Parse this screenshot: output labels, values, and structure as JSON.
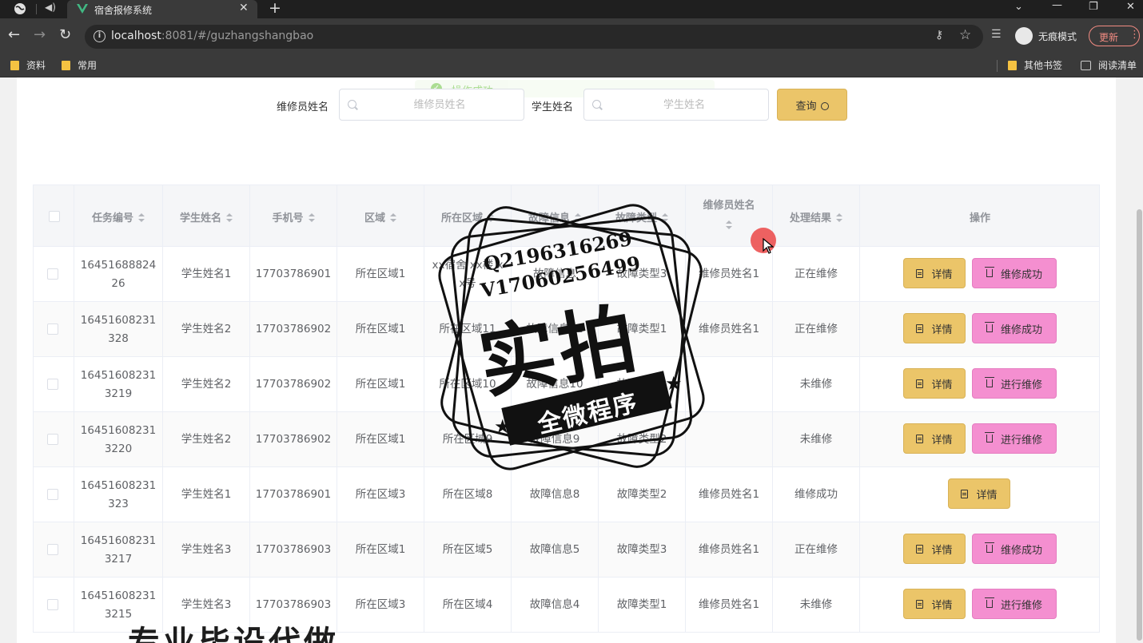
{
  "browser": {
    "tab_title": "宿舍报修系统",
    "url_host": "localhost",
    "url_rest": ":8081/#/guzhangshangbao",
    "incognito_label": "无痕模式",
    "update_label": "更新",
    "bookmarks": [
      "资料",
      "常用"
    ],
    "other_bookmarks": "其他书签",
    "reading_list": "阅读清单"
  },
  "toast": {
    "message": "操作成功"
  },
  "search": {
    "repair_name_label": "维修员姓名",
    "repair_name_placeholder": "维修员姓名",
    "student_name_label": "学生姓名",
    "student_name_placeholder": "学生姓名",
    "query_label": "查询"
  },
  "table": {
    "headers": [
      "任务编号",
      "学生姓名",
      "手机号",
      "区域",
      "所在区域",
      "故障信息",
      "故障类型",
      "维修员姓名",
      "处理结果",
      "操作"
    ],
    "detail_label": "详情",
    "rows": [
      {
        "id": "1645168882426",
        "student": "学生姓名1",
        "phone": "17703786901",
        "area": "所在区域1",
        "location": "xx宿舍 xx楼 xx号",
        "fault": "故障信息",
        "type": "故障类型3",
        "repairer": "维修员姓名1",
        "result": "正在维修",
        "action": "维修成功"
      },
      {
        "id": "16451608231328",
        "student": "学生姓名2",
        "phone": "17703786902",
        "area": "所在区域1",
        "location": "所在区域11",
        "fault": "故障信息11",
        "type": "故障类型1",
        "repairer": "维修员姓名1",
        "result": "正在维修",
        "action": "维修成功"
      },
      {
        "id": "164516082313219",
        "student": "学生姓名2",
        "phone": "17703786902",
        "area": "所在区域1",
        "location": "所在区域10",
        "fault": "故障信息10",
        "type": "故障类型1",
        "repairer": "",
        "result": "未维修",
        "action": "进行维修"
      },
      {
        "id": "164516082313220",
        "student": "学生姓名2",
        "phone": "17703786902",
        "area": "所在区域1",
        "location": "所在区域9",
        "fault": "故障信息9",
        "type": "故障类型2",
        "repairer": "",
        "result": "未维修",
        "action": "进行维修"
      },
      {
        "id": "16451608231323",
        "student": "学生姓名1",
        "phone": "17703786901",
        "area": "所在区域3",
        "location": "所在区域8",
        "fault": "故障信息8",
        "type": "故障类型2",
        "repairer": "维修员姓名1",
        "result": "维修成功",
        "action": ""
      },
      {
        "id": "164516082313217",
        "student": "学生姓名3",
        "phone": "17703786903",
        "area": "所在区域1",
        "location": "所在区域5",
        "fault": "故障信息5",
        "type": "故障类型3",
        "repairer": "维修员姓名1",
        "result": "正在维修",
        "action": "维修成功"
      },
      {
        "id": "164516082313215",
        "student": "学生姓名3",
        "phone": "17703786903",
        "area": "所在区域3",
        "location": "所在区域4",
        "fault": "故障信息4",
        "type": "故障类型1",
        "repairer": "维修员姓名1",
        "result": "未维修",
        "action": "进行维修"
      }
    ]
  },
  "watermark": {
    "qq": "Q2196316269",
    "wechat": "V17060256499",
    "main": "实拍",
    "ribbon": "全微程序",
    "bottom": "专业毕设代做"
  },
  "colors": {
    "detail_button": "#ebc569",
    "action_button": "#f48fd0",
    "success": "#67c23a"
  }
}
